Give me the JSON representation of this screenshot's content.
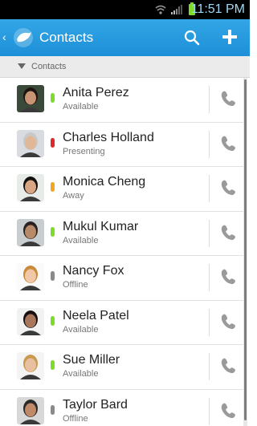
{
  "status_bar": {
    "time": "11:51 PM",
    "battery_icon": "battery-icon",
    "signal_icon": "signal-icon",
    "wifi_icon": "wifi-icon"
  },
  "app_bar": {
    "title": "Contacts",
    "back_icon": "chevron-left-icon",
    "logo_icon": "bird-logo-icon",
    "search_icon": "search-icon",
    "add_icon": "plus-icon",
    "color": "#1d8fd8"
  },
  "section": {
    "label": "Contacts",
    "icon": "triangle-down-icon"
  },
  "status_colors": {
    "Available": "#7ddc2a",
    "Presenting": "#e02a2a",
    "Away": "#f2a622",
    "Offline": "#8a8a8a"
  },
  "contacts": [
    {
      "name": "Anita Perez",
      "presence": "Available",
      "avatar": "avatar-woman-1"
    },
    {
      "name": "Charles Holland",
      "presence": "Presenting",
      "avatar": "avatar-man-1"
    },
    {
      "name": "Monica Cheng",
      "presence": "Away",
      "avatar": "avatar-woman-2"
    },
    {
      "name": "Mukul Kumar",
      "presence": "Available",
      "avatar": "avatar-man-2"
    },
    {
      "name": "Nancy Fox",
      "presence": "Offline",
      "avatar": "avatar-woman-3"
    },
    {
      "name": "Neela Patel",
      "presence": "Available",
      "avatar": "avatar-woman-4"
    },
    {
      "name": "Sue Miller",
      "presence": "Available",
      "avatar": "avatar-woman-5"
    },
    {
      "name": "Taylor Bard",
      "presence": "Offline",
      "avatar": "avatar-man-3"
    }
  ]
}
